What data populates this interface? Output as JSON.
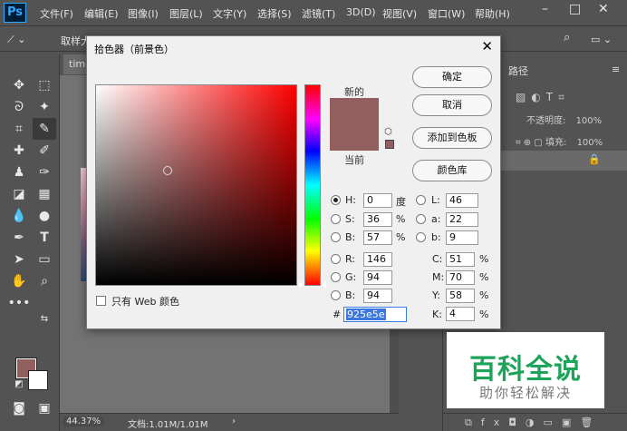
{
  "app": {
    "logo": "Ps",
    "menus": [
      "文件(F)",
      "编辑(E)",
      "图像(I)",
      "图层(L)",
      "文字(Y)",
      "选择(S)",
      "滤镜(T)",
      "3D(D)",
      "视图(V)",
      "窗口(W)",
      "帮助(H)"
    ],
    "window_controls": {
      "minimize": "–",
      "maximize": "□",
      "close": "✕"
    }
  },
  "options_bar": {
    "sample_label": "取样大"
  },
  "document": {
    "tab_label": "timg",
    "zoom": "44.37%",
    "doc_info": "文档:1.01M/1.01M"
  },
  "right_panel": {
    "tab_paths": "路径",
    "opacity_label": "不透明度:",
    "opacity_value": "100%",
    "fill_label": "填充:",
    "fill_value": "100%",
    "layer_name": "景"
  },
  "color_picker": {
    "title": "拾色器（前景色）",
    "label_new": "新的",
    "label_current": "当前",
    "buttons": {
      "ok": "确定",
      "cancel": "取消",
      "add_to_swatches": "添加到色板",
      "color_libraries": "颜色库"
    },
    "only_web_colors": "只有 Web 颜色",
    "selected_color": "#925e5e",
    "fields": {
      "H": {
        "label": "H:",
        "value": "0",
        "unit": "度"
      },
      "S": {
        "label": "S:",
        "value": "36",
        "unit": "%"
      },
      "Bv": {
        "label": "B:",
        "value": "57",
        "unit": "%"
      },
      "R": {
        "label": "R:",
        "value": "146"
      },
      "G": {
        "label": "G:",
        "value": "94"
      },
      "Bc": {
        "label": "B:",
        "value": "94"
      },
      "L": {
        "label": "L:",
        "value": "46"
      },
      "a": {
        "label": "a:",
        "value": "22"
      },
      "b": {
        "label": "b:",
        "value": "9"
      },
      "C": {
        "label": "C:",
        "value": "51",
        "unit": "%"
      },
      "M": {
        "label": "M:",
        "value": "70",
        "unit": "%"
      },
      "Y": {
        "label": "Y:",
        "value": "58",
        "unit": "%"
      },
      "K": {
        "label": "K:",
        "value": "4",
        "unit": "%"
      }
    },
    "hex_hash": "#",
    "hex_value": "925e5e"
  },
  "watermark": {
    "title": "百科全说",
    "subtitle": "助你轻松解决"
  }
}
